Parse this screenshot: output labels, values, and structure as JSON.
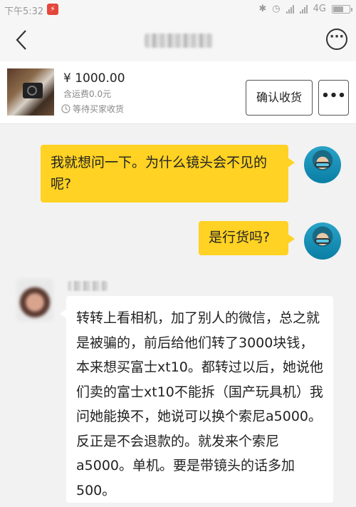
{
  "status_bar": {
    "time": "下午5:32",
    "network": "4G"
  },
  "header": {
    "back_icon": "chevron-left-icon",
    "more_icon": "more-horizontal-icon"
  },
  "product": {
    "price": "¥ 1000.00",
    "shipping": "含运费0.0元",
    "status": "等待买家收货",
    "confirm_button": "确认收货",
    "more_button": "•••"
  },
  "messages": [
    {
      "sender": "me",
      "text": "我就想问一下。为什么镜头会不见的呢?"
    },
    {
      "sender": "me",
      "text": "是行货吗?"
    },
    {
      "sender": "them",
      "text": "转转上看相机，加了别人的微信，总之就是被骗的，前后给他们转了3000块钱，本来想买富士xt10。都转过以后，她说他们卖的富士xt10不能拆（国产玩具机）我问她能换不，她说可以换个索尼a5000。反正是不会退款的。就发来个索尼a5000。单机。要是带镜头的话多加500。"
    }
  ],
  "colors": {
    "my_bubble": "#ffd223",
    "their_bubble": "#ffffff",
    "background": "#f2f2f2"
  }
}
